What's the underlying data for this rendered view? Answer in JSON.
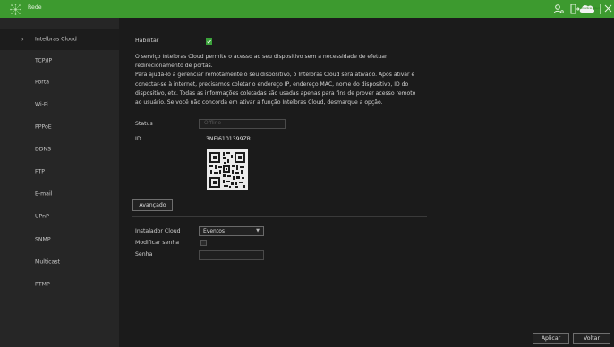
{
  "header": {
    "title": "Rede",
    "icons": [
      "user-settings-icon",
      "logout-icon",
      "intelbras-cloud-icon",
      "close-icon"
    ],
    "cloud_badge_text": "Intelbras Cloud"
  },
  "sidebar": {
    "items": [
      {
        "label": "Intelbras Cloud",
        "active": true
      },
      {
        "label": "TCP/IP"
      },
      {
        "label": "Porta"
      },
      {
        "label": "Wi-Fi"
      },
      {
        "label": "PPPoE"
      },
      {
        "label": "DDNS"
      },
      {
        "label": "FTP"
      },
      {
        "label": "E-mail"
      },
      {
        "label": "UPnP"
      },
      {
        "label": "SNMP"
      },
      {
        "label": "Multicast"
      },
      {
        "label": "RTMP"
      }
    ]
  },
  "main": {
    "enable_label": "Habilitar",
    "enable_checked": true,
    "description_lines": [
      "O serviço Intelbras Cloud permite o acesso ao seu dispositivo sem a necessidade de efetuar",
      "redirecionamento de portas.",
      "Para ajudá-lo a gerenciar remotamente o seu dispositivo, o Intelbras Cloud será ativado. Após ativar e",
      "conectar-se à internet, precisamos coletar o endereço IP, endereço MAC, nome do dispositivo, ID do",
      "dispositivo, etc. Todas as informações coletadas são usadas apenas para fins de prover acesso remoto",
      "ao usuário. Se você não concorda em ativar a função Intelbras Cloud, desmarque a opção."
    ],
    "status_label": "Status",
    "status_value": "Offline",
    "id_label": "ID",
    "id_value": "3NFI6101399ZR",
    "advanced_button": "Avançado",
    "installer_label": "Instalador Cloud",
    "installer_value": "Eventos",
    "modify_password_label": "Modificar senha",
    "modify_password_checked": false,
    "password_label": "Senha",
    "password_value": ""
  },
  "footer": {
    "apply_button": "Aplicar",
    "back_button": "Voltar"
  },
  "colors": {
    "header": "#3d9a2f",
    "sidebar": "#262626",
    "background": "#1b1b1b",
    "checkbox_checked": "#3aa13a"
  }
}
